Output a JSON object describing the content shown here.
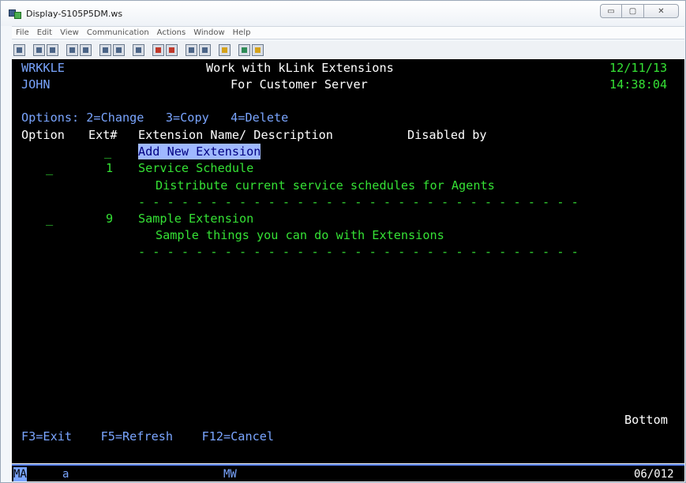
{
  "window": {
    "title": "Display-S105P5DM.ws",
    "controls": {
      "minimize": "▭",
      "maximize": "▢",
      "close": "✕"
    }
  },
  "menu": [
    "File",
    "Edit",
    "View",
    "Communication",
    "Actions",
    "Window",
    "Help"
  ],
  "screen": {
    "program": "WRKKLE",
    "title": "Work with kLink Extensions",
    "date": "12/11/13",
    "user": "JOHN",
    "subtitle": "For Customer Server",
    "time": "14:38:04",
    "options": "Options: 2=Change   3=Copy   4=Delete",
    "headers": {
      "option": "Option",
      "ext": "Ext#",
      "name": "Extension Name/ Description",
      "disabled": "Disabled by"
    },
    "add_new": {
      "option": "_",
      "label": "Add New Extension"
    },
    "rows": [
      {
        "option": "_",
        "ext": "1",
        "name": "Service Schedule",
        "description": "Distribute current service schedules for Agents"
      },
      {
        "option": "_",
        "ext": "9",
        "name": "Sample Extension",
        "description": "Sample things you can do with Extensions"
      }
    ],
    "separator": "- - - - - - - - - - - - - - - - - - - - - - - - - - - - - - -",
    "bottom": "Bottom",
    "function_keys": "F3=Exit    F5=Refresh    F12=Cancel"
  },
  "status": {
    "mode": "MA",
    "indicator": "a",
    "mw": "MW",
    "cursor": "06/012"
  },
  "colors": {
    "screen_bg": "#000000",
    "text_green": "#35e135",
    "text_blue": "#7aa5ff",
    "highlight": "#9fb8ff"
  }
}
